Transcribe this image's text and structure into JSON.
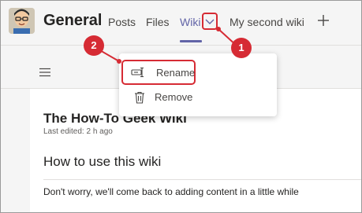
{
  "header": {
    "title": "General",
    "tabs": [
      {
        "label": "Posts"
      },
      {
        "label": "Files"
      },
      {
        "label": "Wiki"
      },
      {
        "label": "My second wiki"
      }
    ],
    "add_icon": "plus-icon",
    "chevron_icon": "chevron-down-icon"
  },
  "toolbar": {
    "menu_icon": "hamburger-icon"
  },
  "menu": {
    "items": [
      {
        "label": "Rename",
        "icon": "rename-icon"
      },
      {
        "label": "Remove",
        "icon": "trash-icon"
      }
    ]
  },
  "wiki": {
    "title": "The How-To Geek Wiki",
    "last_edited": "Last edited: 2 h ago",
    "section_title": "How to use this wiki",
    "paragraph": "Don't worry, we'll come back to adding content in a little while"
  },
  "callouts": [
    "1",
    "2"
  ],
  "colors": {
    "accent": "#6264a7",
    "callout": "#d62b34"
  }
}
